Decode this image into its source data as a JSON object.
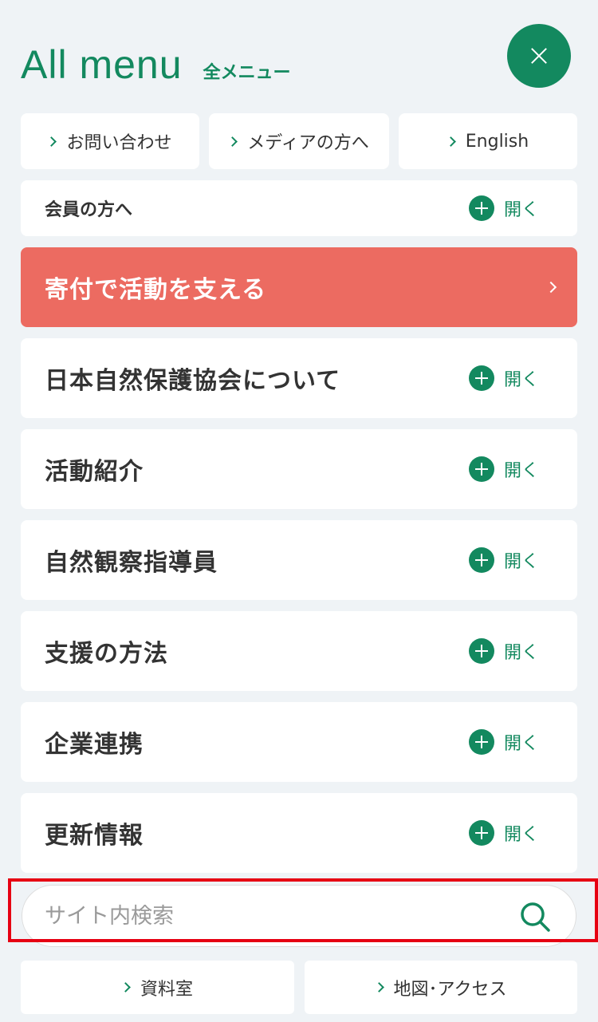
{
  "header": {
    "title_en": "All menu",
    "title_ja": "全メニュー"
  },
  "close_button": {
    "icon": "close-icon"
  },
  "quick_links": [
    {
      "label": "お問い合わせ"
    },
    {
      "label": "メディアの方へ"
    },
    {
      "label": "English"
    }
  ],
  "member": {
    "label": "会員の方へ",
    "toggle": "開く"
  },
  "donate": {
    "label": "寄付で活動を支える"
  },
  "menu_items": [
    {
      "label": "日本自然保護協会について",
      "toggle": "開く"
    },
    {
      "label": "活動紹介",
      "toggle": "開く"
    },
    {
      "label": "自然観察指導員",
      "toggle": "開く"
    },
    {
      "label": "支援の方法",
      "toggle": "開く"
    },
    {
      "label": "企業連携",
      "toggle": "開く"
    },
    {
      "label": "更新情報",
      "toggle": "開く"
    }
  ],
  "search": {
    "placeholder": "サイト内検索",
    "value": ""
  },
  "bottom_links": [
    {
      "label": "資料室"
    },
    {
      "label": "地図･アクセス"
    }
  ],
  "colors": {
    "accent": "#13895f",
    "donate": "#ec6b61",
    "background": "#eff3f6",
    "highlight": "#e60012"
  }
}
